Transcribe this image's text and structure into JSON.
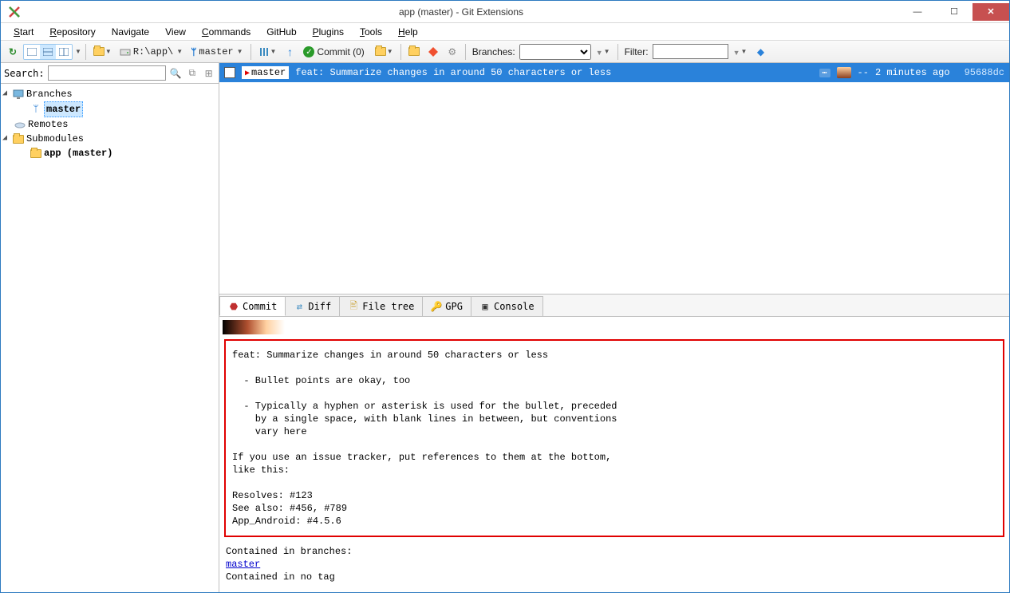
{
  "window": {
    "title": "app (master) - Git Extensions"
  },
  "menu": {
    "start": "Start",
    "repository": "Repository",
    "navigate": "Navigate",
    "view": "View",
    "commands": "Commands",
    "github": "GitHub",
    "plugins": "Plugins",
    "tools": "Tools",
    "help": "Help"
  },
  "toolbar": {
    "repo_path": "R:\\app\\",
    "branch": "master",
    "commit_label": "Commit (0)",
    "branches_label": "Branches:",
    "filter_label": "Filter:"
  },
  "sidebar": {
    "search_label": "Search:",
    "branches_label": "Branches",
    "master": "master",
    "remotes_label": "Remotes",
    "submodules_label": "Submodules",
    "submodule_app": "app (master)"
  },
  "commit_row": {
    "tag": "master",
    "message": "feat: Summarize changes in around 50 characters or less",
    "dashes": "--",
    "time": "2 minutes ago",
    "hash": "95688dc"
  },
  "tabs": {
    "commit": "Commit",
    "diff": "Diff",
    "filetree": "File tree",
    "gpg": "GPG",
    "console": "Console"
  },
  "commit_detail": {
    "message": "feat: Summarize changes in around 50 characters or less\n\n  - Bullet points are okay, too\n\n  - Typically a hyphen or asterisk is used for the bullet, preceded\n    by a single space, with blank lines in between, but conventions\n    vary here\n\nIf you use an issue tracker, put references to them at the bottom,\nlike this:\n\nResolves: #123\nSee also: #456, #789\nApp_Android: #4.5.6",
    "contained_branches": "Contained in branches:",
    "master_link": "master",
    "contained_tags": "Contained in no tag"
  }
}
